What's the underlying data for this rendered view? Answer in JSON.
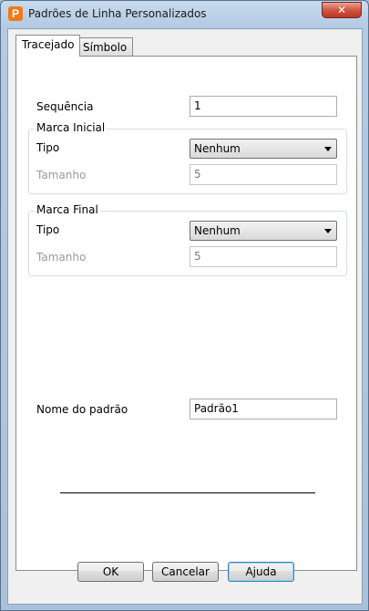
{
  "window": {
    "title": "Padrões de Linha Personalizados",
    "app_icon_letter": "P",
    "close_glyph": "✕"
  },
  "tabs": [
    {
      "label": "Tracejado",
      "active": true
    },
    {
      "label": "Símbolo",
      "active": false
    }
  ],
  "form": {
    "sequence_label": "Sequência",
    "sequence_value": "1",
    "start_marker": {
      "group_label": "Marca Inicial",
      "type_label": "Tipo",
      "type_value": "Nenhum",
      "size_label": "Tamanho",
      "size_value": "5"
    },
    "end_marker": {
      "group_label": "Marca Final",
      "type_label": "Tipo",
      "type_value": "Nenhum",
      "size_label": "Tamanho",
      "size_value": "5"
    },
    "pattern_name_label": "Nome do padrão",
    "pattern_name_value": "Padrão1"
  },
  "buttons": {
    "ok": "OK",
    "cancel": "Cancelar",
    "help": "Ajuda"
  }
}
